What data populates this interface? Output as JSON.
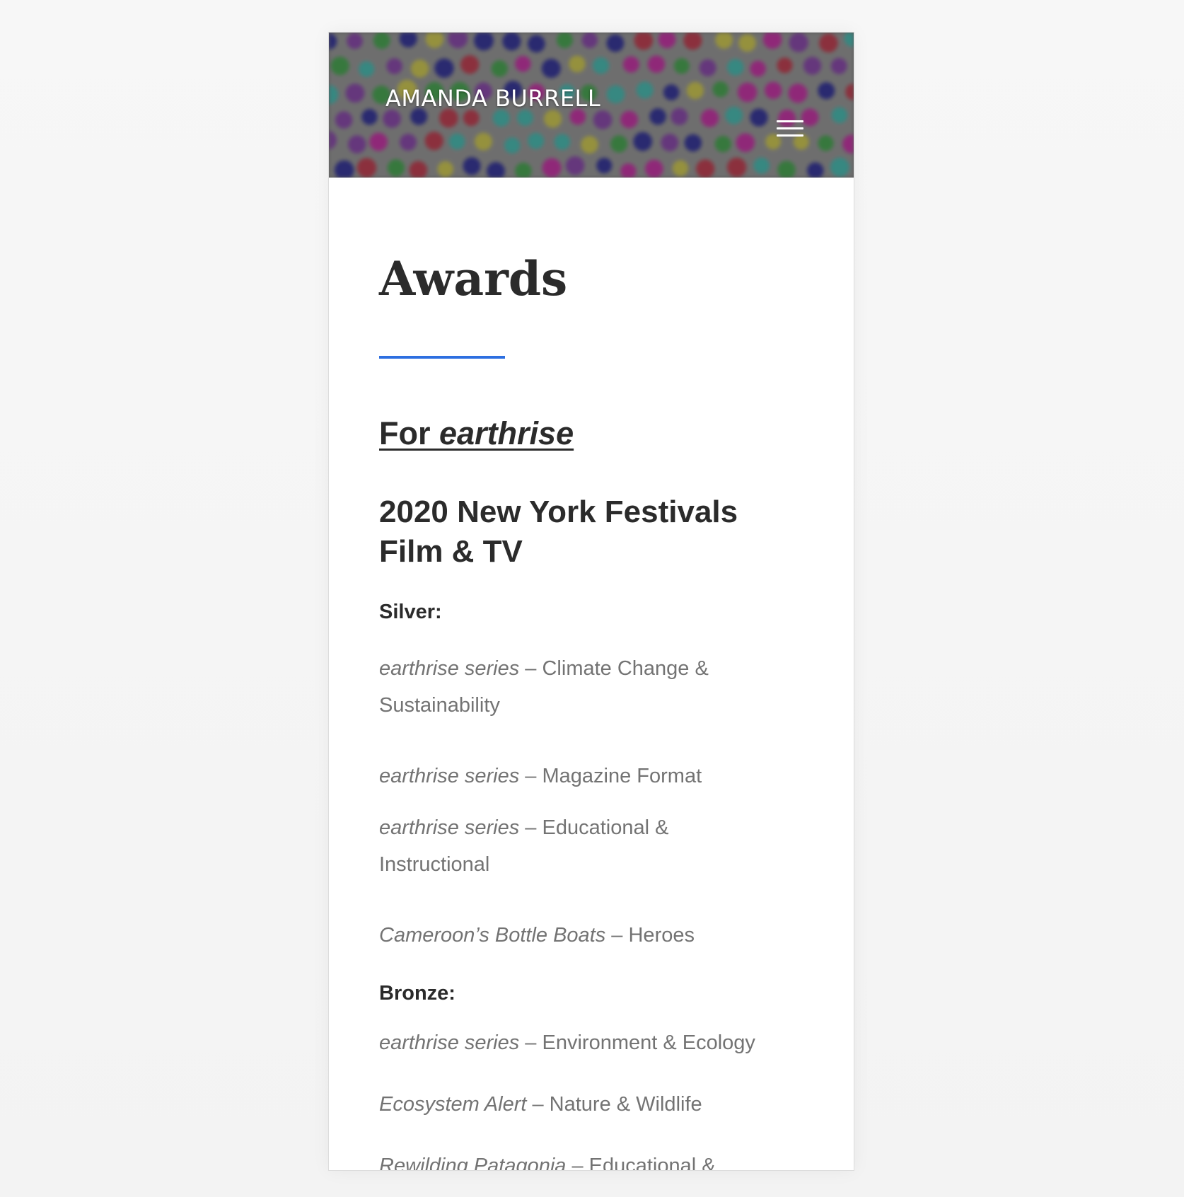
{
  "header": {
    "site_title": "AMANDA BURRELL",
    "menu_icon": "hamburger-menu-icon"
  },
  "page": {
    "title": "Awards",
    "accent_color": "#2d6fe0"
  },
  "section": {
    "link_prefix": "For ",
    "link_italic": "earthrise",
    "festival": "2020 New York Festivals Film & TV",
    "silver_label": "Silver:",
    "silver": [
      {
        "work": "earthrise series",
        "category": " – Climate Change & Sustainability"
      },
      {
        "work": "earthrise series",
        "category": " – Magazine Format"
      },
      {
        "work": "earthrise series",
        "category": " – Educational & Instructional"
      },
      {
        "work": "Cameroon’s Bottle Boats",
        "category": " – Heroes"
      }
    ],
    "bronze_label": "Bronze:",
    "bronze": [
      {
        "work": "earthrise series",
        "category": " – Environment & Ecology"
      },
      {
        "work": "Ecosystem Alert",
        "category": " – Nature & Wildlife"
      },
      {
        "work": "Rewilding Patagonia",
        "category": " – Educational &"
      }
    ]
  }
}
